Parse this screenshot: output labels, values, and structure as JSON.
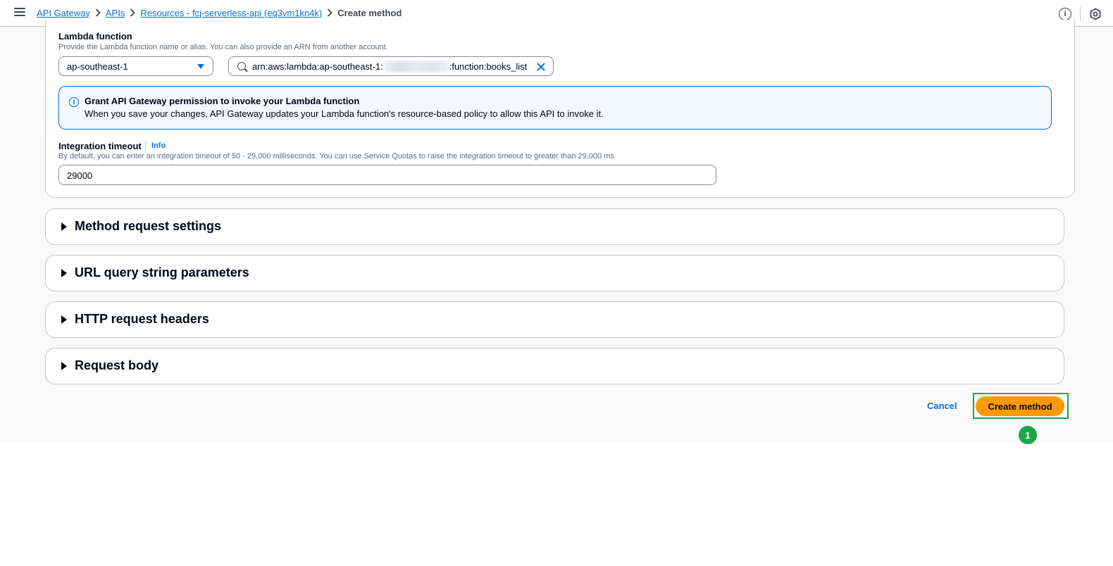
{
  "breadcrumb": {
    "items": [
      "API Gateway",
      "APIs",
      "Resources - fcj-serverless-api (eq3vm1kn4k)"
    ],
    "current": "Create method"
  },
  "lambda": {
    "label": "Lambda function",
    "description": "Provide the Lambda function name or alias. You can also provide an ARN from another account.",
    "region": "ap-southeast-1",
    "arn_prefix": "arn:aws:lambda:ap-southeast-1:",
    "arn_suffix": ":function:books_list"
  },
  "alert": {
    "title": "Grant API Gateway permission to invoke your Lambda function",
    "body": "When you save your changes, API Gateway updates your Lambda function's resource-based policy to allow this API to invoke it."
  },
  "timeout": {
    "label": "Integration timeout",
    "info": "Info",
    "description": "By default, you can enter an integration timeout of 50 - 29,000 milliseconds. You can use Service Quotas to raise the integration timeout to greater than 29,000 ms",
    "value": "29000"
  },
  "sections": [
    "Method request settings",
    "URL query string parameters",
    "HTTP request headers",
    "Request body"
  ],
  "actions": {
    "cancel": "Cancel",
    "create": "Create method",
    "step": "1"
  },
  "colors": {
    "link": "#0972d3",
    "primary_button": "#ff9900",
    "highlight": "#1fa64a"
  }
}
